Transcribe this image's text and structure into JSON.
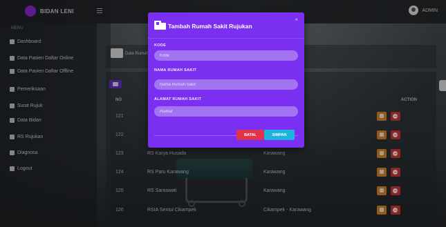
{
  "brand": {
    "name": "BIDAN LENI"
  },
  "user": {
    "name": "ADMIN"
  },
  "sidebar": {
    "title": "MENU",
    "items": [
      {
        "label": "Dashboard",
        "icon": "dashboard-icon"
      },
      {
        "label": "Data Pasien Daftar Online",
        "icon": "users-icon"
      },
      {
        "label": "Data Pasien Daftar Offline",
        "icon": "users-icon"
      },
      {
        "label": "Pemeriksaan",
        "icon": "stethoscope-icon"
      },
      {
        "label": "Surat Rujuk",
        "icon": "letter-icon"
      },
      {
        "label": "Data Bidan",
        "icon": "user-icon"
      },
      {
        "label": "RS Rujukan",
        "icon": "hospital-icon"
      },
      {
        "label": "Diagnosa",
        "icon": "clipboard-icon"
      },
      {
        "label": "Logout",
        "icon": "logout-icon"
      }
    ]
  },
  "page": {
    "title": "Data Rumah Sakit Rujukan"
  },
  "table": {
    "header": {
      "no": "NO",
      "action": "ACTION"
    },
    "rows": [
      {
        "no": "121",
        "nama": "",
        "alamat": ""
      },
      {
        "no": "122",
        "nama": "",
        "alamat": ""
      },
      {
        "no": "123",
        "nama": "RS Karya Husada",
        "alamat": "Karawang"
      },
      {
        "no": "124",
        "nama": "RS Paru Karawang",
        "alamat": "Karawang"
      },
      {
        "no": "125",
        "nama": "RS Saraswati",
        "alamat": "Karawang"
      },
      {
        "no": "126",
        "nama": "RSIA Sentul Cikampek",
        "alamat": "Cikampek - Karawang"
      }
    ]
  },
  "modal": {
    "title": "Tambah Rumah Sakit Rujukan",
    "close": "×",
    "fields": {
      "kode": {
        "label": "KODE",
        "placeholder": "Kode",
        "value": ""
      },
      "nama": {
        "label": "NAMA RUMAH SAKIT",
        "placeholder": "Nama Rumah Sakit",
        "value": ""
      },
      "alamat": {
        "label": "ALAMAT RUMAH SAKIT",
        "placeholder": "Alamat",
        "value": ""
      }
    },
    "buttons": {
      "batal": "BATAL",
      "simpan": "SIMPAN"
    }
  },
  "colors": {
    "modal": "#7b2ff0",
    "input": "#a374f2",
    "batal": "#e0344a",
    "simpan": "#1fb4e0",
    "edit": "#e08a22",
    "delete": "#d63a3a"
  }
}
